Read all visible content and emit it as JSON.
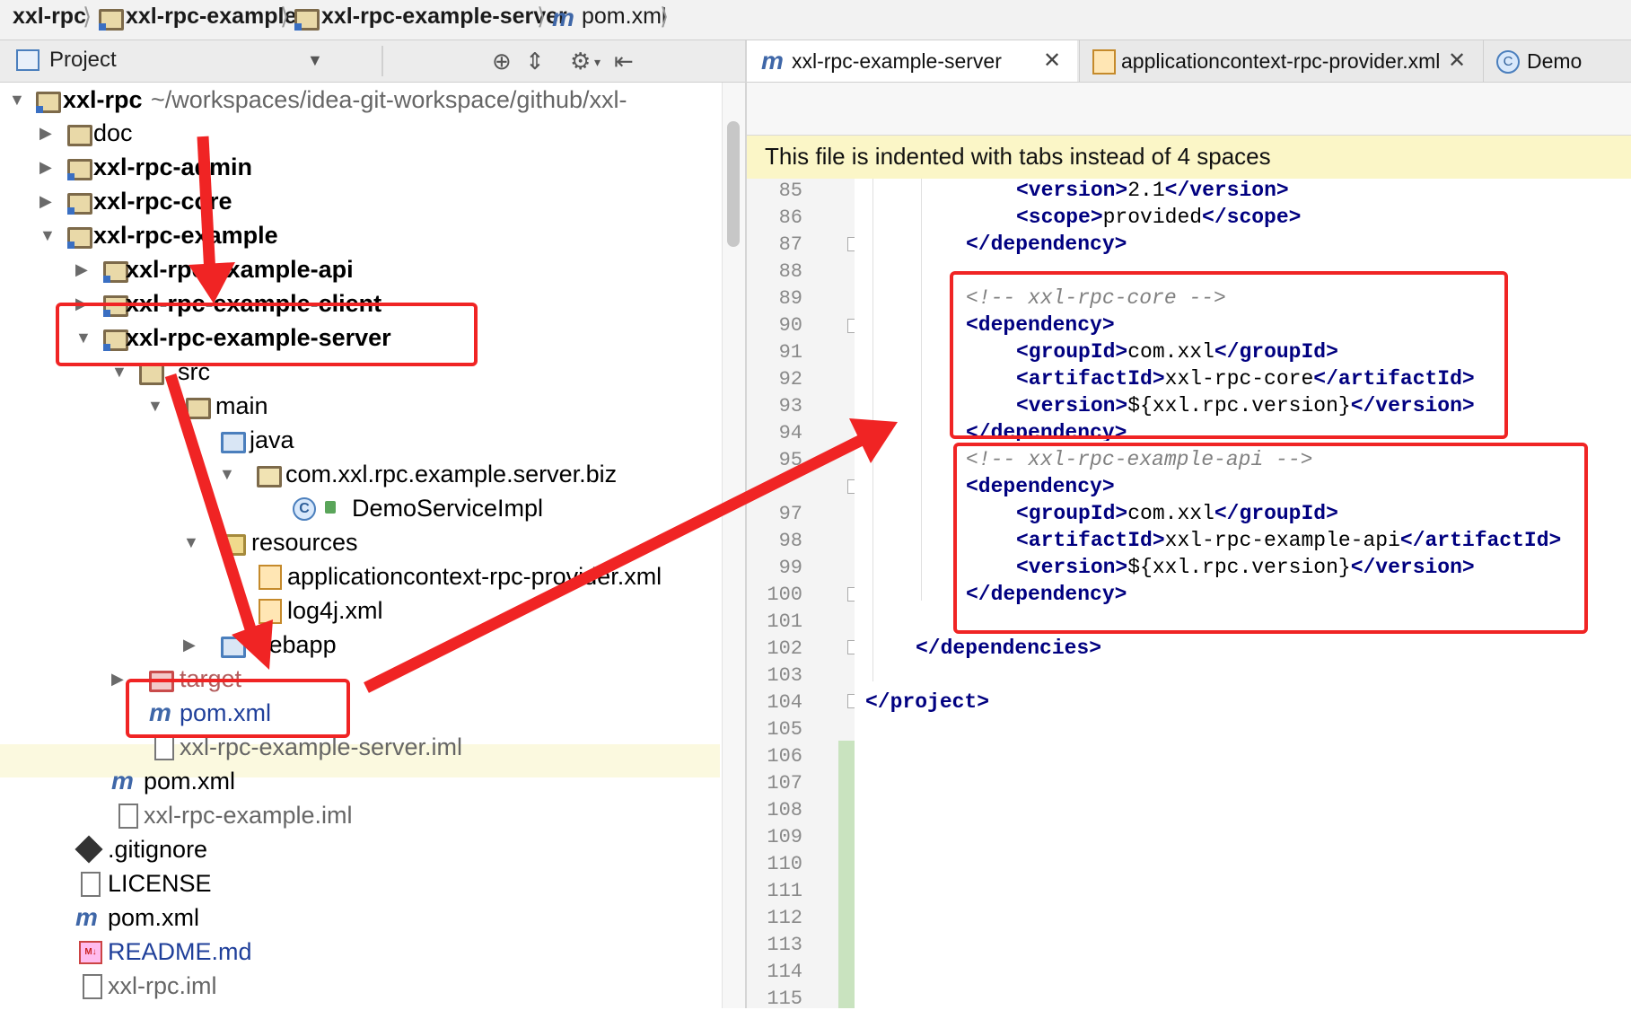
{
  "breadcrumb": {
    "items": [
      "xxl-rpc",
      "xxl-rpc-example",
      "xxl-rpc-example-server",
      "pom.xml"
    ],
    "separator": "⟩"
  },
  "project_panel": {
    "title": "Project",
    "toolbar_icons": [
      "locate-icon",
      "collapse-icon",
      "gear-icon",
      "hide-icon"
    ]
  },
  "tree": {
    "root_name": "xxl-rpc",
    "root_path": "~/workspaces/idea-git-workspace/github/xxl-",
    "items": {
      "doc": "doc",
      "admin": "xxl-rpc-admin",
      "core": "xxl-rpc-core",
      "example": "xxl-rpc-example",
      "example_api": "xxl-rpc-example-api",
      "example_client": "xxl-rpc-example-client",
      "example_server": "xxl-rpc-example-server",
      "src": "src",
      "main": "main",
      "java": "java",
      "package": "com.xxl.rpc.example.server.biz",
      "impl_class": "DemoServiceImpl",
      "resources": "resources",
      "app_context": "applicationcontext-rpc-provider.xml",
      "log4j": "log4j.xml",
      "webapp": "webapp",
      "target": "target",
      "server_pom": "pom.xml",
      "server_iml": "xxl-rpc-example-server.iml",
      "example_pom": "pom.xml",
      "example_iml": "xxl-rpc-example.iml",
      "gitignore": ".gitignore",
      "license": "LICENSE",
      "root_pom": "pom.xml",
      "readme": "README.md",
      "root_iml": "xxl-rpc.iml"
    }
  },
  "editor_tabs": [
    {
      "label": "xxl-rpc-example-server",
      "active": true
    },
    {
      "label": "applicationcontext-rpc-provider.xml",
      "active": false
    },
    {
      "label": "Demo",
      "active": false
    }
  ],
  "banner": {
    "text": "This file is indented with tabs instead of 4 spaces"
  },
  "line_numbers": [
    "85",
    "86",
    "87",
    "88",
    "89",
    "90",
    "91",
    "92",
    "93",
    "94",
    "95",
    "",
    "97",
    "98",
    "99",
    "100",
    "101",
    "102",
    "103",
    "104",
    "105",
    "106",
    "107",
    "108",
    "109",
    "110",
    "111",
    "112",
    "113",
    "114",
    "115"
  ],
  "code": {
    "l85_open": "<version>",
    "l85_val": "2.1",
    "l85_close": "</version>",
    "l86_open": "<scope>",
    "l86_val": "provided",
    "l86_close": "</scope>",
    "l87": "</dependency>",
    "l89": "<!-- xxl-rpc-core -->",
    "l90": "<dependency>",
    "l91_open": "<groupId>",
    "l91_val": "com.xxl",
    "l91_close": "</groupId>",
    "l92_open": "<artifactId>",
    "l92_val": "xxl-rpc-core",
    "l92_close": "</artifactId>",
    "l93_open": "<version>",
    "l93_val": "${xxl.rpc.version}",
    "l93_close": "</version>",
    "l94": "</dependency>",
    "l95": "<!-- xxl-rpc-example-api -->",
    "l96": "<dependency>",
    "l97_open": "<groupId>",
    "l97_val": "com.xxl",
    "l97_close": "</groupId>",
    "l98_open": "<artifactId>",
    "l98_val": "xxl-rpc-example-api",
    "l98_close": "</artifactId>",
    "l99_open": "<version>",
    "l99_val": "${xxl.rpc.version}",
    "l99_close": "</version>",
    "l100": "</dependency>",
    "l102": "</dependencies>",
    "l104": "</project>"
  },
  "colors": {
    "annotation_red": "#f02424",
    "xml_tag": "#000080",
    "comment": "#808080",
    "banner_bg": "#fbf6c7"
  }
}
